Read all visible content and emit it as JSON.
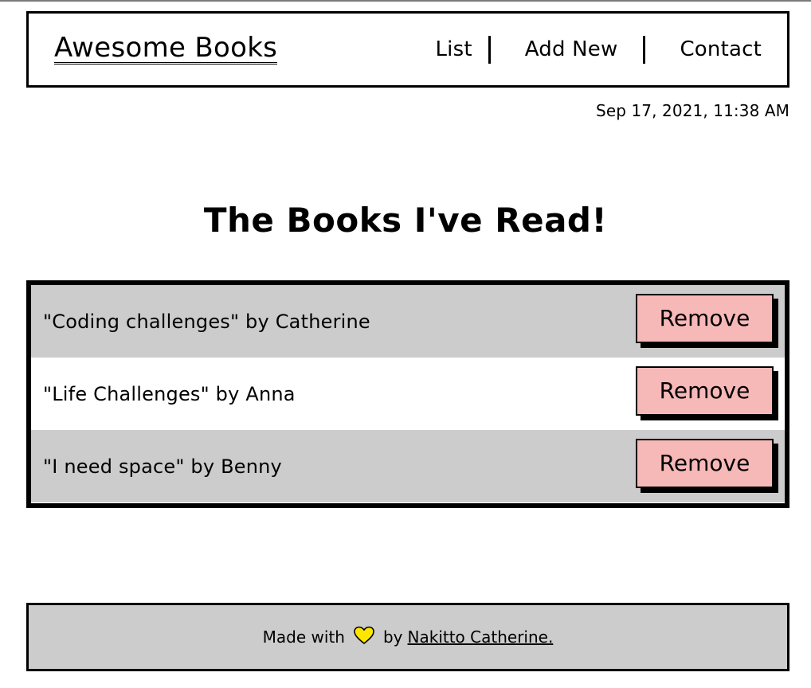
{
  "header": {
    "brand": "Awesome Books",
    "nav": {
      "list": "List",
      "add_new": "Add New",
      "contact": "Contact"
    }
  },
  "datetime": "Sep 17, 2021, 11:38 AM",
  "main": {
    "title": "The Books I've Read!",
    "books": [
      {
        "text": "\"Coding challenges\" by Catherine",
        "action": "Remove"
      },
      {
        "text": "\"Life Challenges\" by Anna",
        "action": "Remove"
      },
      {
        "text": "\"I need space\" by Benny",
        "action": "Remove"
      }
    ]
  },
  "footer": {
    "made_with": "Made with",
    "by": "by",
    "author": "Nakitto Catherine.",
    "heart_icon": "heart-icon",
    "heart_color": "#ffe600"
  },
  "colors": {
    "row_gray": "#cccccc",
    "button_pink": "#f7b8b8",
    "footer_bg": "#cccccc"
  }
}
